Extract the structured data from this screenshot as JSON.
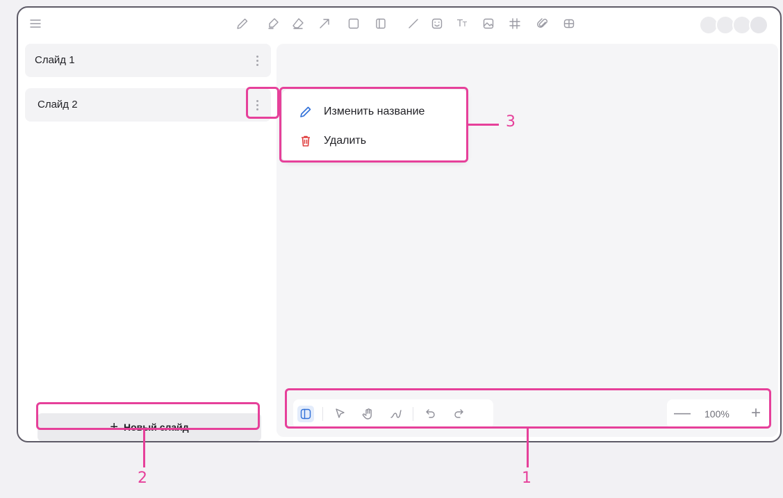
{
  "slides": [
    {
      "label": "Слайд 1"
    },
    {
      "label": "Слайд 2"
    }
  ],
  "new_slide": {
    "icon": "+",
    "label": "Новый слайд"
  },
  "context_menu": {
    "items": [
      {
        "label": "Изменить название",
        "icon": "pencil-icon"
      },
      {
        "label": "Удалить",
        "icon": "trash-icon"
      }
    ]
  },
  "toolbar": {
    "icons": [
      "menu-icon",
      "pencil-icon",
      "marker-icon",
      "eraser-icon",
      "arrow-icon",
      "rectangle-icon",
      "sticky-note-icon",
      "line-icon",
      "sticker-icon",
      "text-icon",
      "image-icon",
      "grid-icon",
      "attachment-icon",
      "table-icon"
    ]
  },
  "bottom_tools": {
    "icons": [
      "panel-toggle-icon",
      "cursor-icon",
      "hand-icon",
      "laser-icon",
      "undo-icon",
      "redo-icon"
    ]
  },
  "zoom": {
    "minus": "—",
    "value": "100%",
    "plus": "+"
  },
  "callouts": {
    "one": "1",
    "two": "2",
    "three": "3"
  },
  "colors": {
    "highlight": "#e6409a",
    "accent": "#2f6fd8",
    "delete": "#e04040"
  }
}
